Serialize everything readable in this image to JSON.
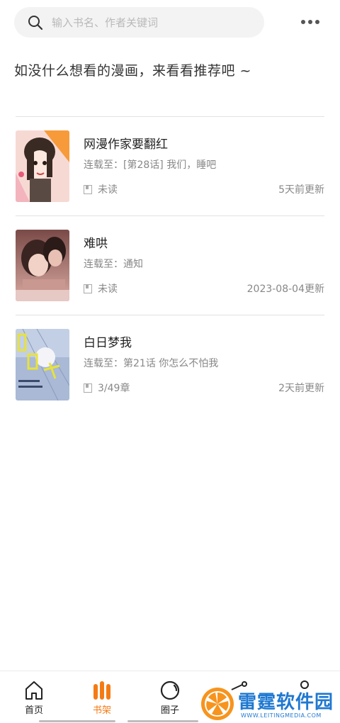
{
  "search": {
    "placeholder": "输入书名、作者关键词"
  },
  "prompt_text": "如没什么想看的漫画，来看看推荐吧 ~",
  "books": [
    {
      "title": "网漫作家要翻红",
      "update": "连载至：[第28话] 我们，睡吧",
      "status": "未读",
      "time": "5天前更新"
    },
    {
      "title": "难哄",
      "update": "连载至：通知",
      "status": "未读",
      "time": "2023-08-04更新"
    },
    {
      "title": "白日梦我",
      "update": "连载至：第21话 你怎么不怕我",
      "status": "3/49章",
      "time": "2天前更新"
    }
  ],
  "nav": [
    {
      "label": "首页",
      "icon": "home-icon",
      "active": false
    },
    {
      "label": "书架",
      "icon": "bookshelf-icon",
      "active": true
    },
    {
      "label": "圈子",
      "icon": "circle-icon",
      "active": false
    }
  ],
  "watermark": {
    "title": "雷霆软件园",
    "subtitle": "WWW.LEITINGMEDIA.COM"
  },
  "colors": {
    "accent": "#f47b14",
    "text": "#222222",
    "muted": "#888888",
    "divider": "#e2e2e2"
  }
}
